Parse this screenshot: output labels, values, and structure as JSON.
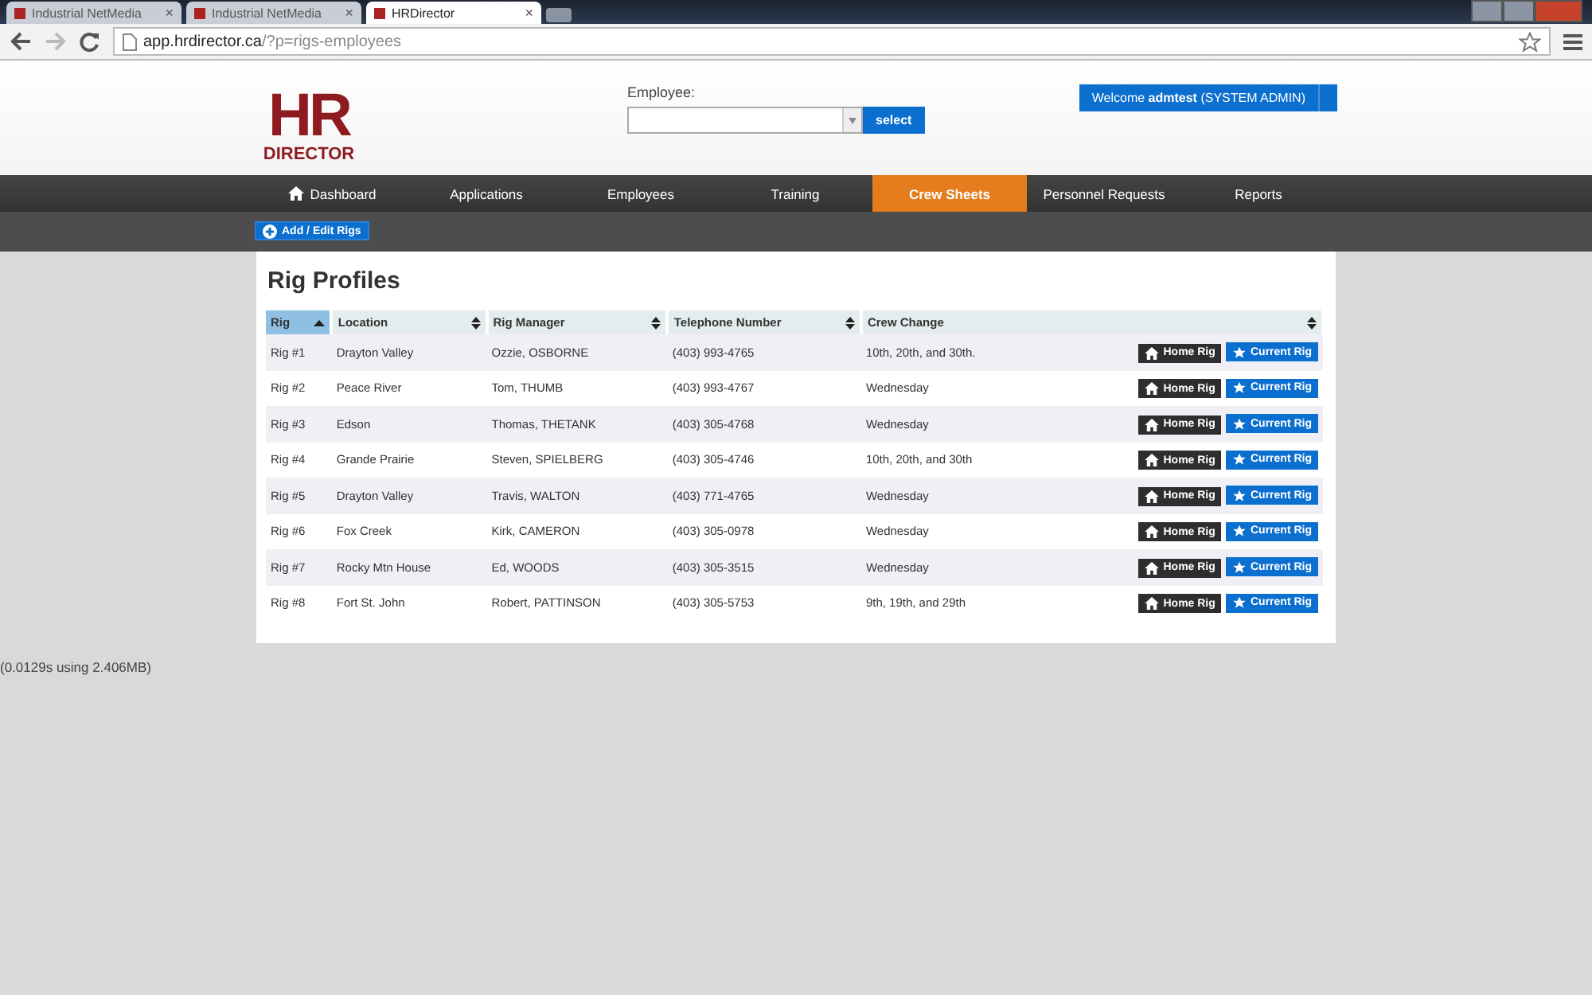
{
  "browser": {
    "tabs": [
      {
        "title": "Industrial NetMedia",
        "selected": false
      },
      {
        "title": "Industrial NetMedia",
        "selected": false
      },
      {
        "title": "HRDirector",
        "selected": true
      }
    ],
    "close_glyph": "×",
    "address": {
      "host": "app.hrdirector.ca",
      "path": "/?p=rigs-employees"
    }
  },
  "header": {
    "logo": {
      "top": "HR",
      "bottom": "DIRECTOR"
    },
    "employee_label": "Employee:",
    "select_button": "select",
    "welcome": "Welcome **admtest** (SYSTEM ADMIN)"
  },
  "nav": [
    {
      "label": "Dashboard",
      "selected": false,
      "icon": true
    },
    {
      "label": "Applications",
      "selected": false,
      "icon": false
    },
    {
      "label": "Employees",
      "selected": false,
      "icon": false
    },
    {
      "label": "Training",
      "selected": false,
      "icon": false
    },
    {
      "label": "Crew Sheets",
      "selected": true,
      "icon": false
    },
    {
      "label": "Personnel Requests",
      "selected": false,
      "icon": false
    },
    {
      "label": "Reports",
      "selected": false,
      "icon": false
    }
  ],
  "add_button": "Add / Edit Rigs",
  "title": "Rig Profiles",
  "table": {
    "columns": [
      {
        "label": "Rig",
        "selected": true
      },
      {
        "label": "Location",
        "selected": false
      },
      {
        "label": "Rig Manager",
        "selected": false
      },
      {
        "label": "Telephone Number",
        "selected": false
      },
      {
        "label": "Crew Change",
        "selected": false
      }
    ],
    "rows": [
      {
        "cells": [
          "Rig #1",
          "Drayton Valley",
          "Ozzie, OSBORNE",
          "(403) 993-4765",
          "10th, 20th, and 30th."
        ],
        "home_label": "Home Rig",
        "current_label": "Current Rig"
      },
      {
        "cells": [
          "Rig #2",
          "Peace River",
          "Tom, THUMB",
          "(403) 993-4767",
          "Wednesday"
        ],
        "home_label": "Home Rig",
        "current_label": "Current Rig"
      },
      {
        "cells": [
          "Rig #3",
          "Edson",
          "Thomas, THETANK",
          "(403) 305-4768",
          "Wednesday"
        ],
        "home_label": "Home Rig",
        "current_label": "Current Rig"
      },
      {
        "cells": [
          "Rig #4",
          "Grande Prairie",
          "Steven, SPIELBERG",
          "(403) 305-4746",
          "10th, 20th, and 30th"
        ],
        "home_label": "Home Rig",
        "current_label": "Current Rig"
      },
      {
        "cells": [
          "Rig #5",
          "Drayton Valley",
          "Travis, WALTON",
          "(403) 771-4765",
          "Wednesday"
        ],
        "home_label": "Home Rig",
        "current_label": "Current Rig"
      },
      {
        "cells": [
          "Rig #6",
          "Fox Creek",
          "Kirk, CAMERON",
          "(403) 305-0978",
          "Wednesday"
        ],
        "home_label": "Home Rig",
        "current_label": "Current Rig"
      },
      {
        "cells": [
          "Rig #7",
          "Rocky Mtn House",
          "Ed, WOODS",
          "(403) 305-3515",
          "Wednesday"
        ],
        "home_label": "Home Rig",
        "current_label": "Current Rig"
      },
      {
        "cells": [
          "Rig #8",
          "Fort St. John",
          "Robert, PATTINSON",
          "(403) 305-5753",
          "9th, 19th, and 29th"
        ],
        "home_label": "Home Rig",
        "current_label": "Current Rig"
      }
    ]
  },
  "footer": "(0.0129s using 2.406MB)"
}
